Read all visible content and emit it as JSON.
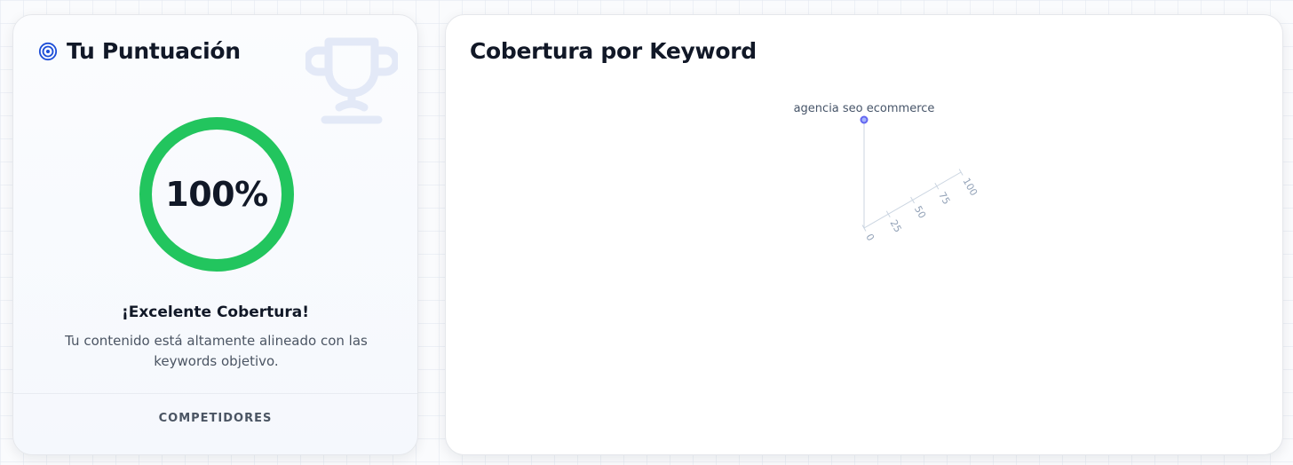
{
  "score_card": {
    "title": "Tu Puntuación",
    "score_text": "100%",
    "score_fraction": 1.0,
    "status_title": "¡Excelente Cobertura!",
    "status_description": "Tu contenido está altamente alineado con las keywords objetivo.",
    "competitors_tab": "COMPETIDORES",
    "icons": {
      "title_icon": "target-icon",
      "decorative_icon": "trophy-icon"
    },
    "colors": {
      "ring": "#22c55e",
      "title_icon": "#1d4ed8",
      "trophy": "#e3e9f7"
    }
  },
  "coverage_card": {
    "title": "Cobertura por Keyword",
    "chart_data": {
      "type": "radar",
      "categories": [
        "agencia seo ecommerce"
      ],
      "values": [
        100
      ],
      "radial_ticks": [
        "0",
        "25",
        "50",
        "75",
        "100"
      ],
      "radial_range": [
        0,
        100
      ],
      "colors": {
        "series": "#6366f1",
        "axis": "#cbd5e1",
        "tick_label": "#94a3b8"
      }
    }
  }
}
